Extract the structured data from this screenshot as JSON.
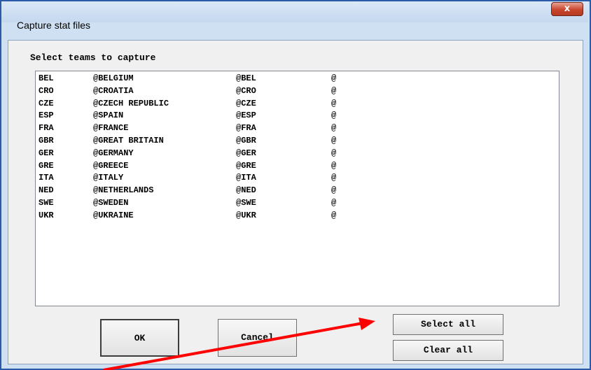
{
  "window": {
    "title": "Capture stat files",
    "close_label": "x"
  },
  "dialog": {
    "prompt": "Select teams to capture",
    "teams": [
      {
        "code": "BEL",
        "name": "@BELGIUM",
        "abbr": "@BEL",
        "extra": "@"
      },
      {
        "code": "CRO",
        "name": "@CROATIA",
        "abbr": "@CRO",
        "extra": "@"
      },
      {
        "code": "CZE",
        "name": "@CZECH REPUBLIC",
        "abbr": "@CZE",
        "extra": "@"
      },
      {
        "code": "ESP",
        "name": "@SPAIN",
        "abbr": "@ESP",
        "extra": "@"
      },
      {
        "code": "FRA",
        "name": "@FRANCE",
        "abbr": "@FRA",
        "extra": "@"
      },
      {
        "code": "GBR",
        "name": "@GREAT BRITAIN",
        "abbr": "@GBR",
        "extra": "@"
      },
      {
        "code": "GER",
        "name": "@GERMANY",
        "abbr": "@GER",
        "extra": "@"
      },
      {
        "code": "GRE",
        "name": "@GREECE",
        "abbr": "@GRE",
        "extra": "@"
      },
      {
        "code": "ITA",
        "name": "@ITALY",
        "abbr": "@ITA",
        "extra": "@"
      },
      {
        "code": "NED",
        "name": "@NETHERLANDS",
        "abbr": "@NED",
        "extra": "@"
      },
      {
        "code": "SWE",
        "name": "@SWEDEN",
        "abbr": "@SWE",
        "extra": "@"
      },
      {
        "code": "UKR",
        "name": "@UKRAINE",
        "abbr": "@UKR",
        "extra": "@"
      }
    ],
    "buttons": {
      "ok": "OK",
      "cancel": "Cancel",
      "select_all": "Select all",
      "clear_all": "Clear all"
    }
  },
  "colors": {
    "annotation_arrow": "#ff0000",
    "frame": "#2a5aa8"
  }
}
